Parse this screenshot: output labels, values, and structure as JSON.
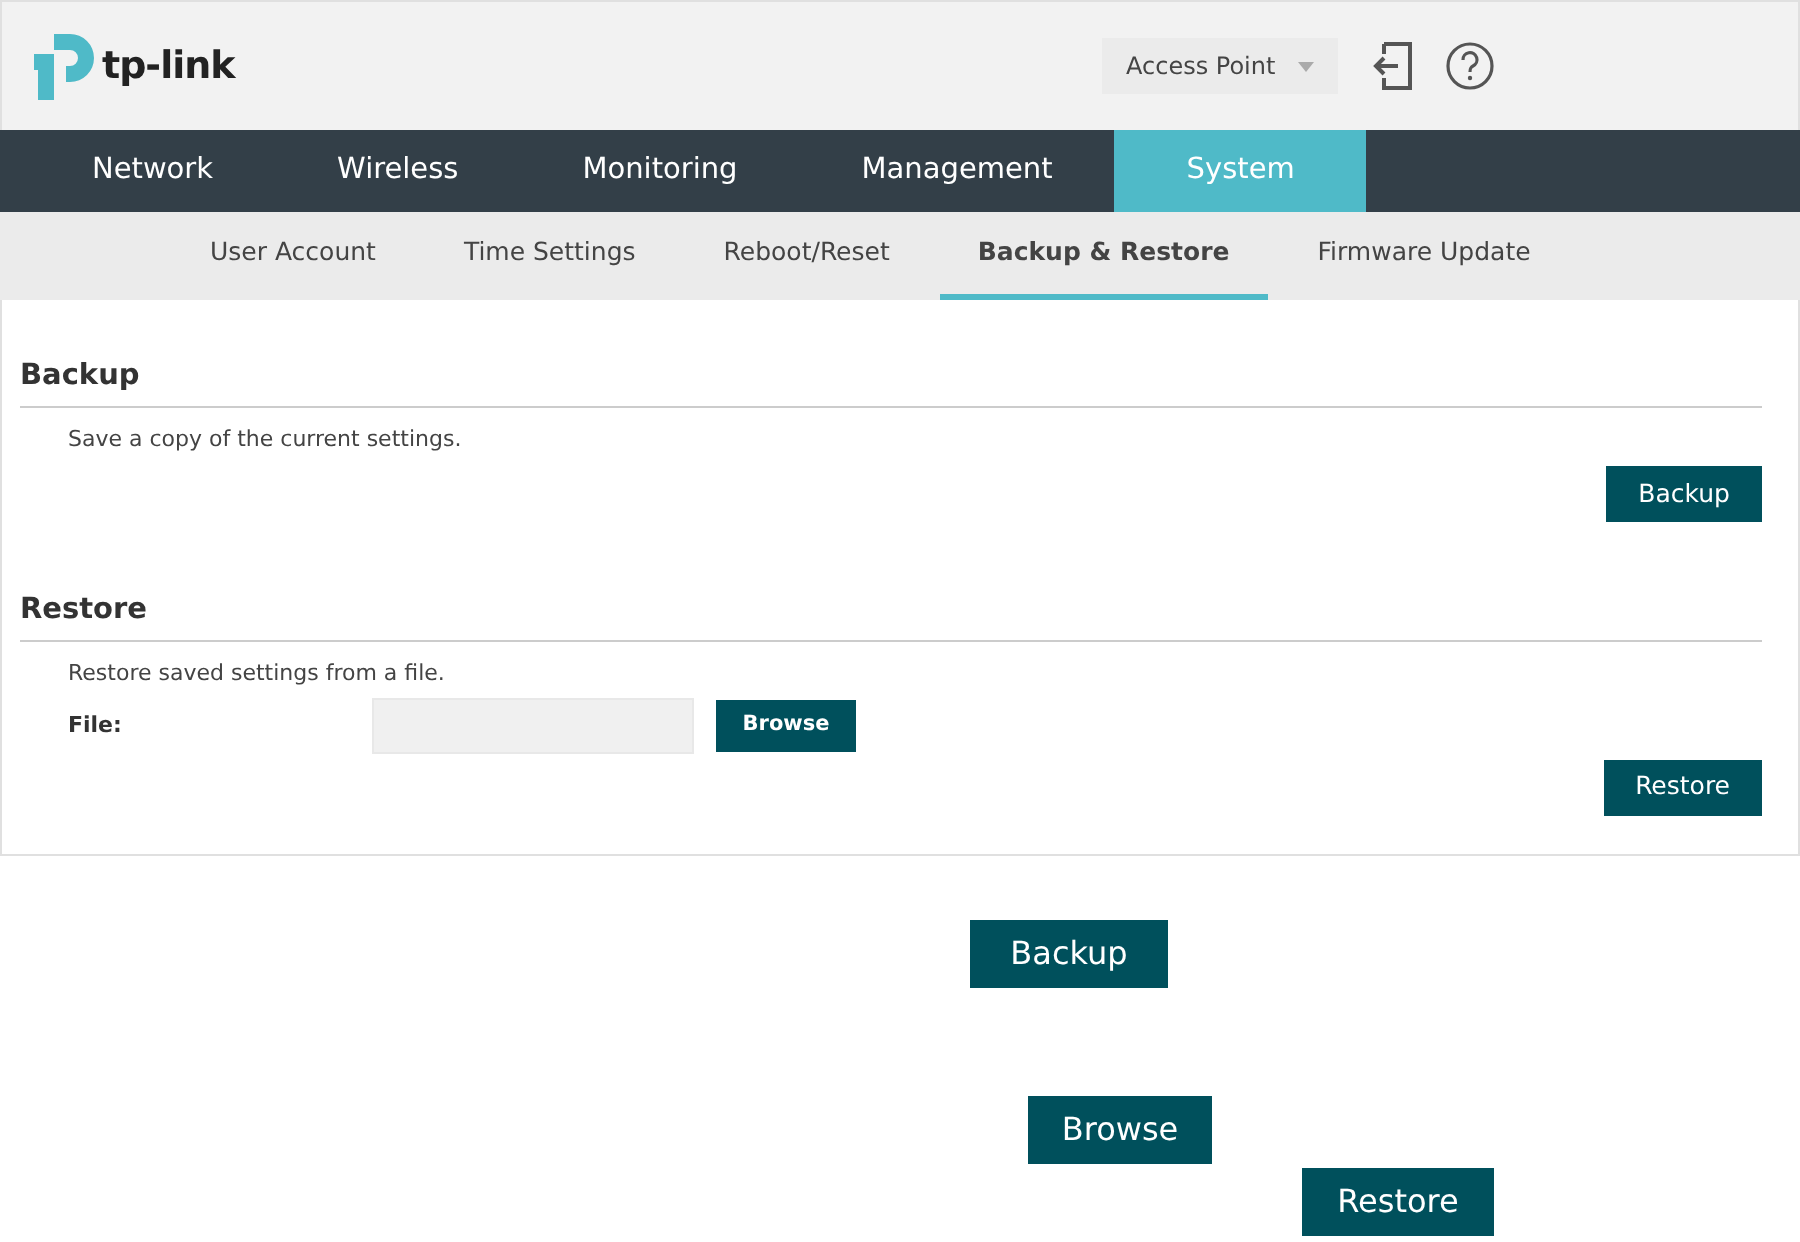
{
  "header": {
    "logo": "tp-link",
    "mode_select": {
      "value": "Access Point"
    }
  },
  "main_tabs": [
    {
      "label": "Network",
      "selected": false
    },
    {
      "label": "Wireless",
      "selected": false
    },
    {
      "label": "Monitoring",
      "selected": false
    },
    {
      "label": "Management",
      "selected": false
    },
    {
      "label": "System",
      "selected": true
    }
  ],
  "sub_tabs": [
    {
      "label": "User Account",
      "selected": false
    },
    {
      "label": "Time Settings",
      "selected": false
    },
    {
      "label": "Reboot/Reset",
      "selected": false
    },
    {
      "label": "Backup & Restore",
      "selected": true
    },
    {
      "label": "Firmware Update",
      "selected": false
    }
  ],
  "backup": {
    "title": "Backup",
    "description": "Save a copy of the current settings.",
    "button": "Backup"
  },
  "restore": {
    "title": "Restore",
    "description": "Restore saved settings from a file.",
    "file_label": "File:",
    "browse_button": "Browse",
    "button": "Restore"
  },
  "enlarged_buttons": [
    "Backup",
    "Browse",
    "Restore"
  ]
}
